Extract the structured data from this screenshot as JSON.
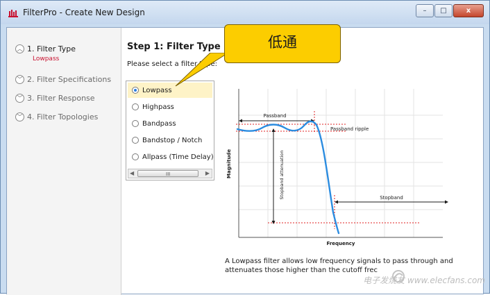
{
  "window": {
    "title": "FilterPro - Create New Design",
    "buttons": {
      "minimize": "–",
      "maximize": "□",
      "close": "x"
    }
  },
  "steps": [
    {
      "label": "1. Filter Type",
      "state": "expanded",
      "selection": "Lowpass"
    },
    {
      "label": "2. Filter Specifications",
      "state": "collapsed"
    },
    {
      "label": "3. Filter Response",
      "state": "collapsed"
    },
    {
      "label": "4. Filter Topologies",
      "state": "collapsed"
    }
  ],
  "main": {
    "title": "Step 1: Filter Type",
    "prompt": "Please select a filter type:",
    "options": [
      {
        "label": "Lowpass",
        "checked": true
      },
      {
        "label": "Highpass",
        "checked": false
      },
      {
        "label": "Bandpass",
        "checked": false
      },
      {
        "label": "Bandstop / Notch",
        "checked": false
      },
      {
        "label": "Allpass (Time Delay)",
        "checked": false
      }
    ],
    "scroll_grip": "III",
    "description": "A Lowpass filter allows low frequency signals to pass through and attenuates those higher than the cutoff frec"
  },
  "diagram": {
    "y_label": "Magnitude",
    "x_label": "Frequency",
    "passband_label": "Passband",
    "ripple_label": "Passband ripple",
    "stopband_atten_label": "Stopband attenuation",
    "stopband_label": "Stopband",
    "curve_color": "#2b8ce0",
    "marker_color": "#e02020"
  },
  "callout": {
    "text": "低通",
    "color": "#fccd00"
  },
  "watermark": {
    "text": "电子发烧友 www.elecfans.com"
  }
}
